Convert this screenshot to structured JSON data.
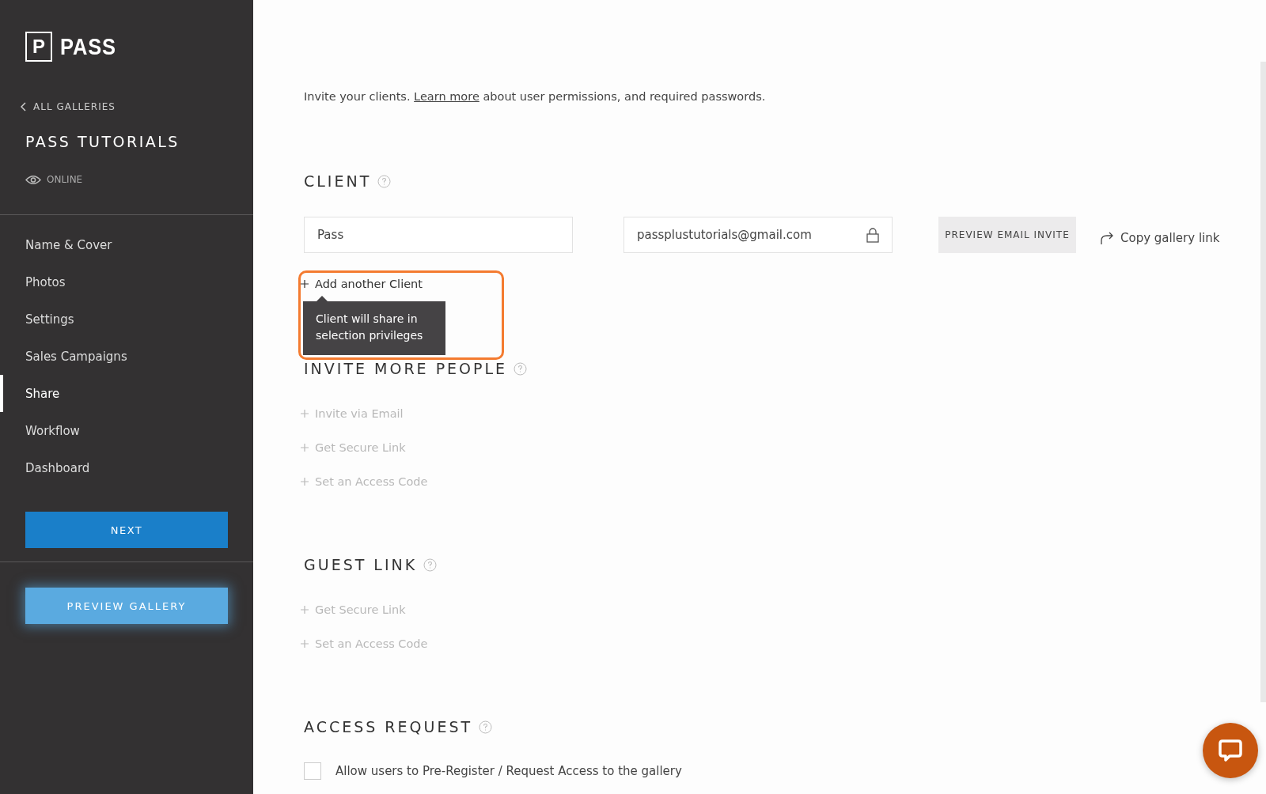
{
  "sidebar": {
    "logo": {
      "mark": "P",
      "text": "PASS"
    },
    "back_link": "ALL GALLERIES",
    "gallery_title": "PASS TUTORIALS",
    "status": "ONLINE",
    "items": [
      {
        "label": "Name & Cover",
        "selected": false
      },
      {
        "label": "Photos",
        "selected": false
      },
      {
        "label": "Settings",
        "selected": false
      },
      {
        "label": "Sales Campaigns",
        "selected": false
      },
      {
        "label": "Share",
        "selected": true
      },
      {
        "label": "Workflow",
        "selected": false
      },
      {
        "label": "Dashboard",
        "selected": false
      }
    ],
    "next_button": "NEXT",
    "preview_button": "PREVIEW GALLERY"
  },
  "intro": {
    "before": "Invite your clients. ",
    "link": "Learn more",
    "after": " about user permissions, and required passwords."
  },
  "client": {
    "heading": "CLIENT",
    "name_value": "Pass",
    "email_value": "passplustutorials@gmail.com",
    "preview_button": "PREVIEW EMAIL INVITE",
    "copy_link": "Copy gallery link",
    "add_link": {
      "label": "Add another Client",
      "disabled": false
    },
    "tooltip": "Client will share in selection privileges"
  },
  "sections": [
    {
      "heading": "INVITE MORE PEOPLE",
      "links": [
        {
          "label": "Invite via Email",
          "disabled": true
        },
        {
          "label": "Get Secure Link",
          "disabled": true
        },
        {
          "label": "Set an Access Code",
          "disabled": true
        }
      ]
    },
    {
      "heading": "GUEST LINK",
      "links": [
        {
          "label": "Get Secure Link",
          "disabled": true
        },
        {
          "label": "Set an Access Code",
          "disabled": true
        }
      ]
    }
  ],
  "access_request": {
    "heading": "ACCESS REQUEST",
    "checkbox": {
      "label": "Allow users to Pre-Register / Request Access to the gallery",
      "checked": false
    }
  }
}
